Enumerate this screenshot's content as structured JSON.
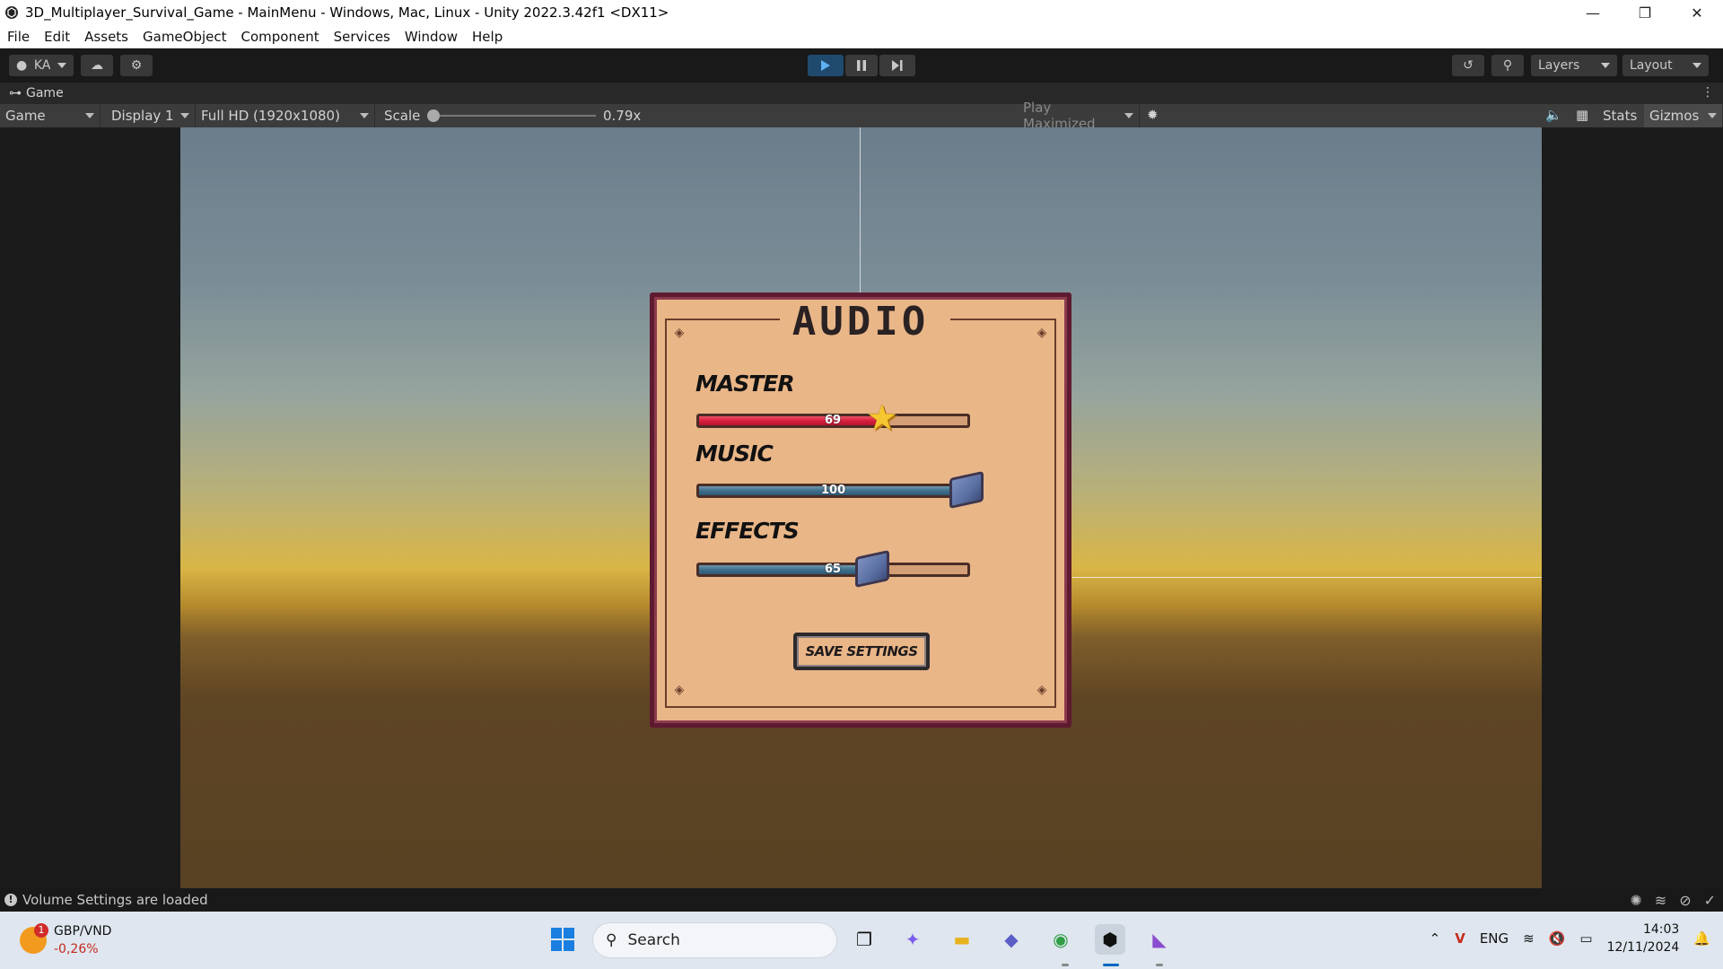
{
  "window": {
    "title": "3D_Multiplayer_Survival_Game - MainMenu - Windows, Mac, Linux - Unity 2022.3.42f1 <DX11>",
    "controls": [
      "—",
      "❐",
      "✕"
    ]
  },
  "menubar": [
    "File",
    "Edit",
    "Assets",
    "GameObject",
    "Component",
    "Services",
    "Window",
    "Help"
  ],
  "toolbar": {
    "account": "KA",
    "layers": "Layers",
    "layout": "Layout"
  },
  "tab": {
    "label": "Game"
  },
  "gamebar": {
    "view": "Game",
    "display": "Display 1",
    "resolution": "Full HD (1920x1080)",
    "scale_label": "Scale",
    "scale_value": "0.79x",
    "play_mode": "Play Maximized",
    "stats": "Stats",
    "gizmos": "Gizmos"
  },
  "audio_panel": {
    "title": "AUDIO",
    "master": {
      "label": "MASTER",
      "value": "69",
      "fraction": 0.69
    },
    "music": {
      "label": "MUSIC",
      "value": "100",
      "fraction": 1.0
    },
    "effects": {
      "label": "EFFECTS",
      "value": "65",
      "fraction": 0.65
    },
    "save_button": "SAVE SETTINGS"
  },
  "status": {
    "message": "Volume Settings are loaded"
  },
  "taskbar": {
    "ticker_symbol": "GBP/VND",
    "ticker_change": "-0,26%",
    "ticker_badge": "1",
    "search_placeholder": "Search",
    "language": "ENG",
    "time": "14:03",
    "date": "12/11/2024"
  },
  "colors": {
    "panel_fill": "#e9b688",
    "panel_border": "#5e1b30",
    "master_fill": "#d81f3d",
    "slider_fill": "#3e6f8c",
    "play_active": "#1f4a6e"
  }
}
